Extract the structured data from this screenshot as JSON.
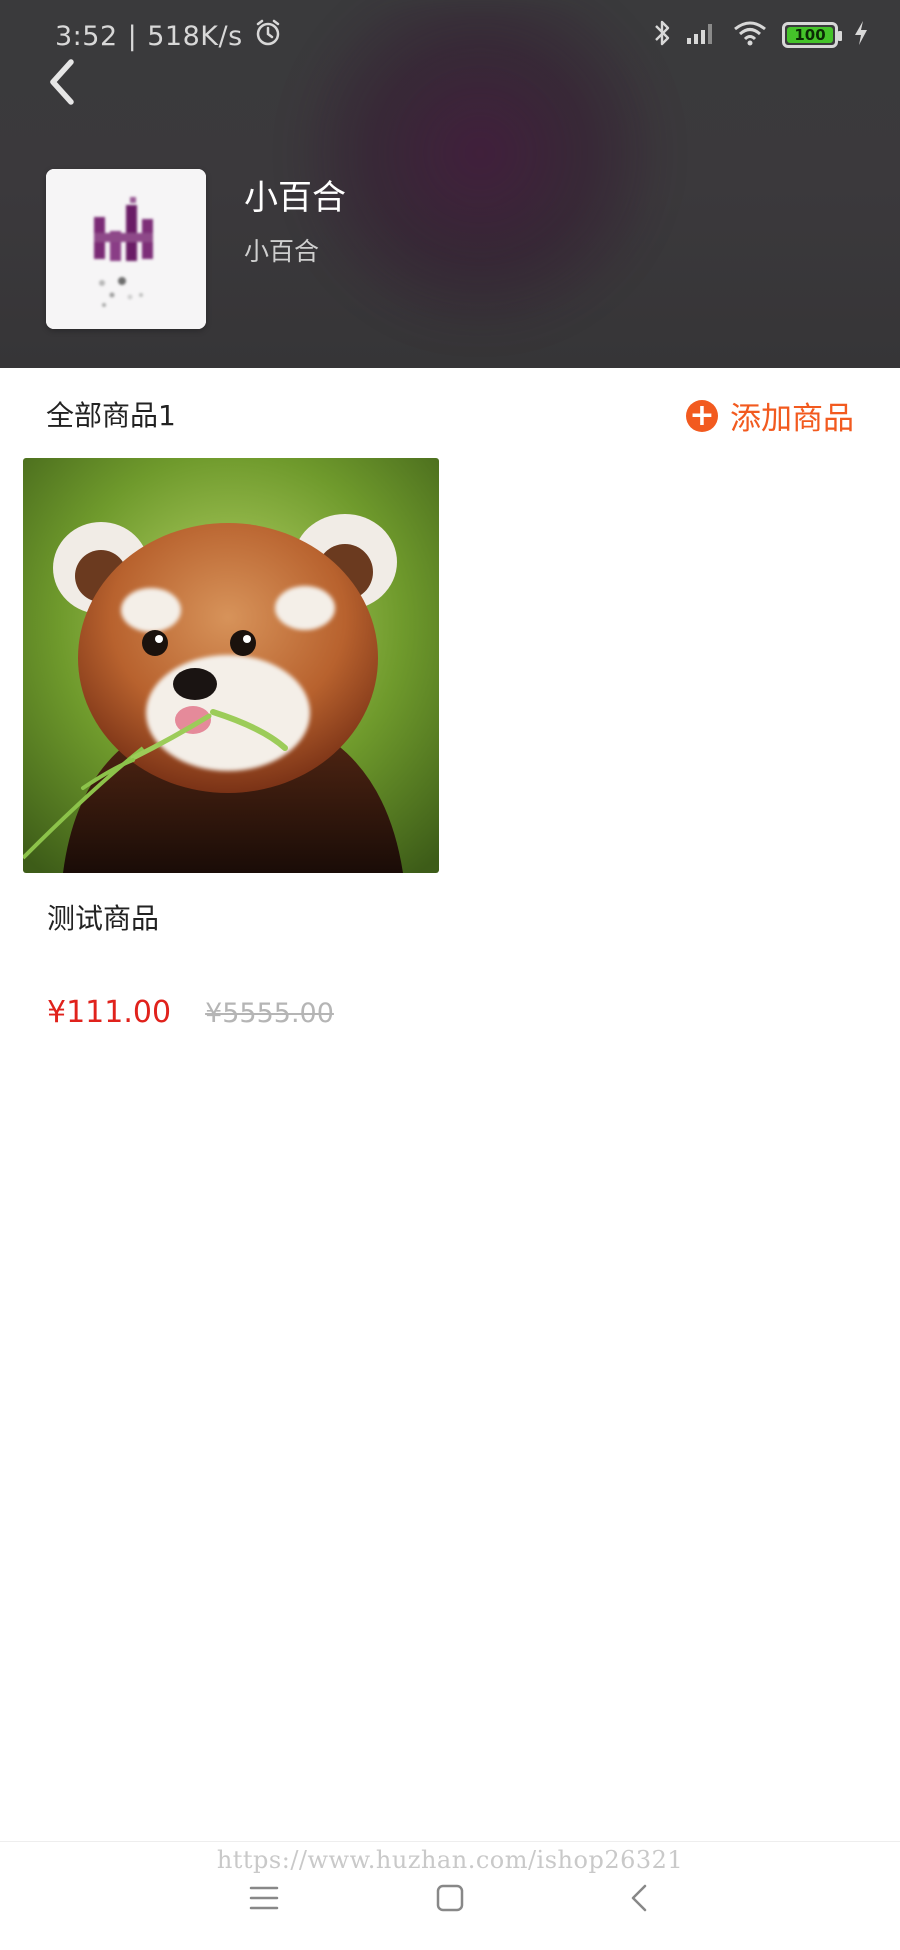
{
  "status_bar": {
    "time": "3:52",
    "separator": "|",
    "net_speed": "518K/s",
    "battery_level": "100",
    "icons": [
      "alarm-icon",
      "bluetooth-icon",
      "signal-icon",
      "wifi-icon",
      "battery-icon",
      "charging-icon"
    ]
  },
  "header": {
    "back_icon": "chevron-left-icon",
    "shop_name": "小百合",
    "shop_desc": "小百合"
  },
  "section": {
    "title": "全部商品1",
    "add_icon": "plus-circle-icon",
    "add_label": "添加商品"
  },
  "products": [
    {
      "name": "测试商品",
      "price": "¥111.00",
      "original_price": "¥5555.00",
      "image": "red-panda-photo"
    }
  ],
  "watermark": "https://www.huzhan.com/ishop26321",
  "nav": {
    "icons": [
      "menu-icon",
      "home-square-icon",
      "back-triangle-icon"
    ]
  },
  "colors": {
    "accent": "#f25a1f",
    "price": "#e0221c",
    "header_bg": "#3a3a3c"
  }
}
